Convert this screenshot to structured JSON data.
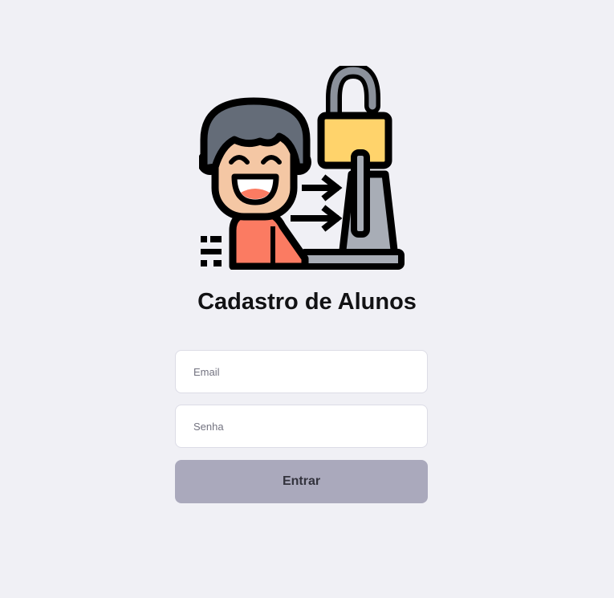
{
  "page": {
    "title": "Cadastro de Alunos"
  },
  "form": {
    "email": {
      "placeholder": "Email",
      "value": ""
    },
    "password": {
      "placeholder": "Senha",
      "value": ""
    },
    "submit_label": "Entrar"
  },
  "illustration": {
    "icon": "student-login-illustration"
  },
  "colors": {
    "background": "#f0f0f5",
    "button": "#aaa9bc",
    "button_text": "#33333d",
    "title": "#121214"
  }
}
